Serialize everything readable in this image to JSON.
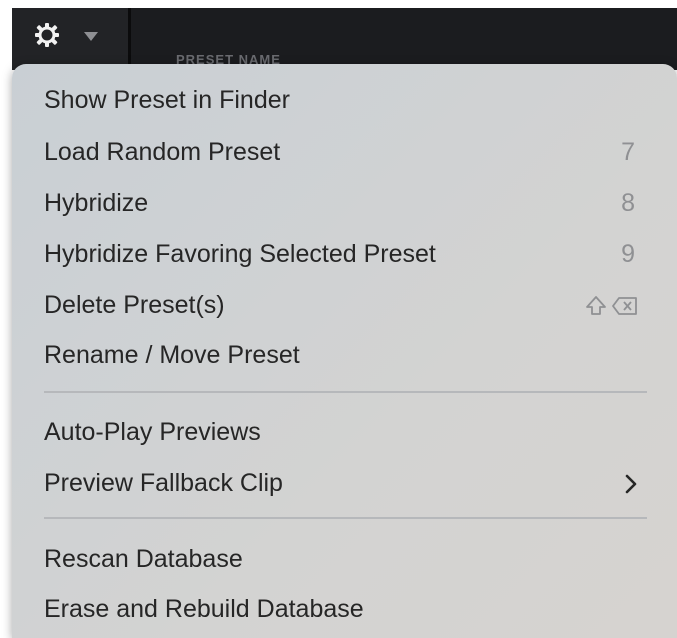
{
  "header": {
    "gear_icon": "gear-icon",
    "caret_icon": "caret-down-icon",
    "column_label": "PRESET NAME"
  },
  "menu": {
    "group1": [
      {
        "label": "Show Preset in Finder",
        "shortcut": ""
      },
      {
        "label": "Load Random Preset",
        "shortcut": "7"
      },
      {
        "label": "Hybridize",
        "shortcut": "8"
      },
      {
        "label": "Hybridize Favoring Selected Preset",
        "shortcut": "9"
      },
      {
        "label": "Delete Preset(s)",
        "shortcut_icons": [
          "shift-icon",
          "delete-key-icon"
        ]
      },
      {
        "label": "Rename / Move Preset",
        "shortcut": ""
      }
    ],
    "group2": [
      {
        "label": "Auto-Play Previews"
      },
      {
        "label": "Preview Fallback Clip",
        "submenu_icon": "chevron-right-icon"
      }
    ],
    "group3": [
      {
        "label": "Rescan Database"
      },
      {
        "label": "Erase and Rebuild Database"
      }
    ]
  }
}
